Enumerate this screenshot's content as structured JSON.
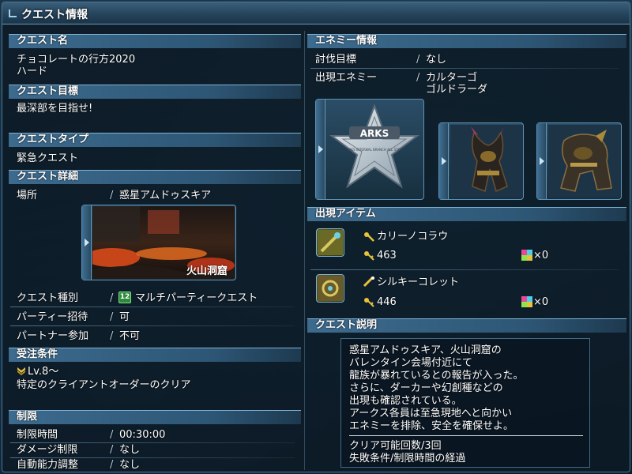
{
  "window": {
    "title": "クエスト情報"
  },
  "left": {
    "quest_name": {
      "header": "クエスト名",
      "name": "チョコレートの行方2020",
      "difficulty": "ハード"
    },
    "quest_goal": {
      "header": "クエスト目標",
      "text": "最深部を目指せ!"
    },
    "quest_type": {
      "header": "クエストタイプ",
      "text": "緊急クエスト"
    },
    "quest_detail": {
      "header": "クエスト詳細",
      "location_label": "場所",
      "location_value": "惑星アムドゥスキア",
      "map_caption": "火山洞窟",
      "kind_label": "クエスト種別",
      "kind_value": "マルチパーティークエスト",
      "kind_badge": "12",
      "party_label": "パーティー招待",
      "party_value": "可",
      "partner_label": "パートナー参加",
      "partner_value": "不可"
    },
    "conditions": {
      "header": "受注条件",
      "level": "Lv.8～",
      "client_order": "特定のクライアントオーダーのクリア"
    },
    "limits": {
      "header": "制限",
      "time_label": "制限時間",
      "time_value": "00:30:00",
      "damage_label": "ダメージ制限",
      "damage_value": "なし",
      "auto_label": "自動能力調整",
      "auto_value": "なし"
    },
    "separator": "/"
  },
  "right": {
    "enemy": {
      "header": "エネミー情報",
      "target_label": "討伐目標",
      "target_value": "なし",
      "appear_label": "出現エネミー",
      "appear_1": "カルターゴ",
      "appear_2": "ゴルドラーダ",
      "boss_label_top": "ARKS",
      "boss_label_sub": "ARKS INTERNAL BRANCH ALL STOP"
    },
    "items": {
      "header": "出現アイテム",
      "list": [
        {
          "name": "カリーノコラウ",
          "count": "463",
          "x_count": "×0"
        },
        {
          "name": "シルキーコレット",
          "count": "446",
          "x_count": "×0"
        }
      ]
    },
    "description": {
      "header": "クエスト説明",
      "lines": [
        "惑星アムドゥスキア、火山洞窟の",
        "バレンタイン会場付近にて",
        "龍族が暴れているとの報告が入った。",
        "さらに、ダーカーや幻創種などの",
        "出現も確認されている。",
        "アークス各員は至急現地へと向かい",
        "エネミーを排除、安全を確保せよ。"
      ],
      "clear_count": "クリア可能回数/3回",
      "fail_condition": "失敗条件/制限時間の経過"
    },
    "separator": "/"
  },
  "colors": {
    "header_bg": "#2d5675",
    "border": "#4a7898",
    "lava": "#d84a1a"
  }
}
